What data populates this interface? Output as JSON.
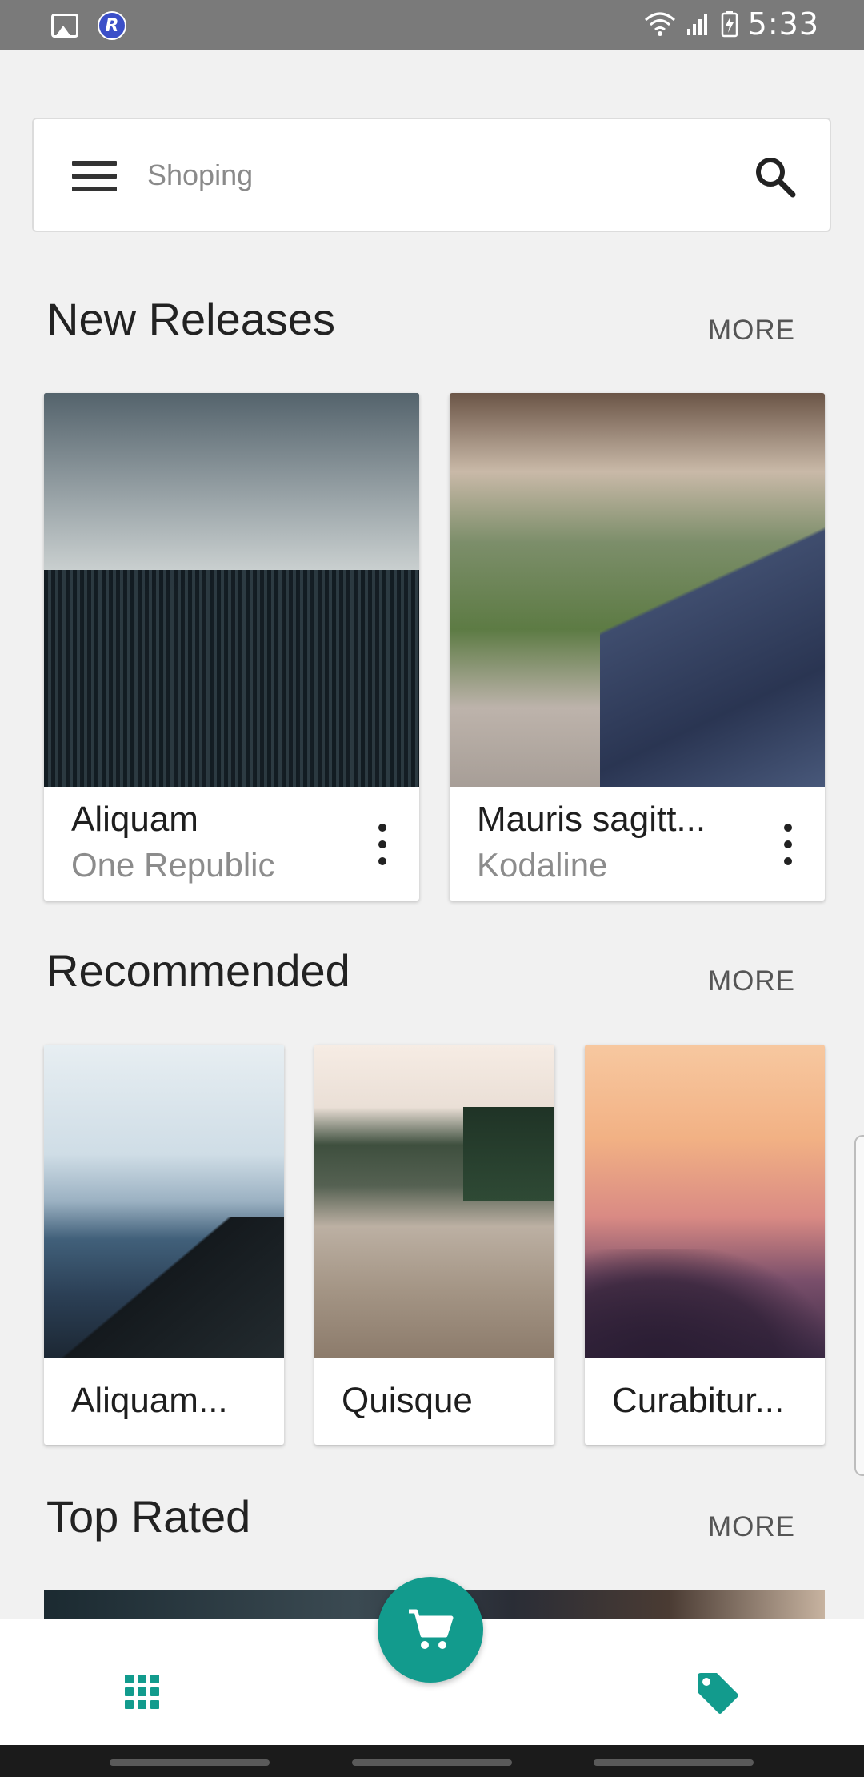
{
  "status_bar": {
    "time": "5:33"
  },
  "search": {
    "placeholder": "Shoping"
  },
  "sections": {
    "new_releases": {
      "title": "New Releases",
      "more_label": "MORE",
      "items": [
        {
          "title": "Aliquam",
          "subtitle": "One Republic",
          "image": "loom-photo"
        },
        {
          "title": "Mauris sagitt...",
          "subtitle": "Kodaline",
          "image": "bench-photo"
        }
      ]
    },
    "recommended": {
      "title": "Recommended",
      "more_label": "MORE",
      "items": [
        {
          "title": "Aliquam...",
          "image": "mountain-photo"
        },
        {
          "title": "Quisque",
          "image": "dock-photo"
        },
        {
          "title": "Curabitur...",
          "image": "sunset-photo"
        }
      ]
    },
    "top_rated": {
      "title": "Top Rated",
      "more_label": "MORE"
    }
  },
  "bottom_bar": {
    "left_icon": "grid-icon",
    "center_icon": "cart-icon",
    "right_icon": "tag-icon"
  },
  "colors": {
    "accent": "#129b8d",
    "background": "#f1f1f1",
    "status_bar": "#7a7a7a"
  }
}
